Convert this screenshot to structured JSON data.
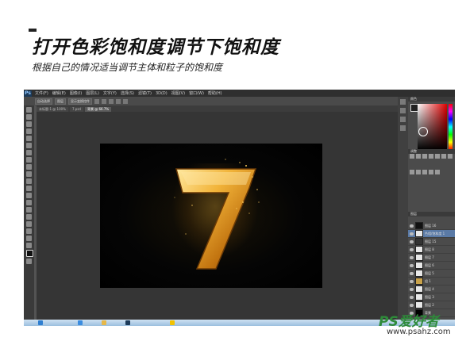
{
  "header": {
    "title": "打开色彩饱和度调节下饱和度",
    "subtitle": "根据自己的情况适当调节主体和粒子的饱和度"
  },
  "photoshop": {
    "logo": "Ps",
    "menu": [
      "文件(F)",
      "编辑(E)",
      "图像(I)",
      "图层(L)",
      "文字(Y)",
      "选择(S)",
      "滤镜(T)",
      "3D(D)",
      "视图(V)",
      "窗口(W)",
      "帮助(H)"
    ],
    "options": [
      "自动选择",
      "图层",
      "显示变换控件"
    ],
    "doc_tabs": [
      "未标题-1 @ 100%",
      "7.psd",
      "背景 @ 66.7%"
    ],
    "status": "100%",
    "panels": {
      "color_tab": "颜色",
      "adjust_tab": "调整",
      "layers_tab": "图层",
      "layers": [
        "图层 16",
        "色相/饱和度 1",
        "图层 15",
        "图层 8",
        "图层 7",
        "图层 6",
        "图层 5",
        "组 1",
        "图层 4",
        "图层 3",
        "图层 2",
        "背景"
      ]
    },
    "colors": {
      "accent": "#e8b23a",
      "fg": "#222222",
      "picker_hue": "#e00000"
    }
  },
  "watermark": {
    "brand": "PS爱好者",
    "url": "www.psahz.com"
  }
}
